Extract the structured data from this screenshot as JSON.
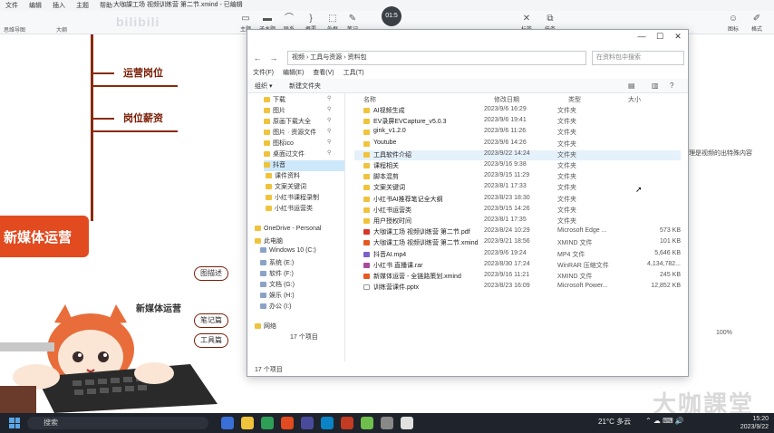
{
  "app": {
    "menu": [
      "文件",
      "编辑",
      "插入",
      "主题",
      "帮助"
    ],
    "title": "大咖課工场 视频训练营 第二节.xmind - 已编辑",
    "left_tools": [
      "思维导图",
      "大纲"
    ],
    "timer": "01:5",
    "toolbar_right": [
      "图标",
      "格式"
    ],
    "toolbar_mid": [
      "主题",
      "子主题",
      "联系",
      "概要",
      "外框",
      "笔记",
      "标签",
      "任务"
    ],
    "watermark": "bilibili"
  },
  "mindmap": {
    "central": "新媒体运营",
    "topics": [
      "运营岗位",
      "岗位薪资"
    ],
    "sub_topic": "新媒体运营",
    "small_nodes": [
      "图描述",
      "笔记篇",
      "工具篇"
    ],
    "right_note": "理是视频的出特殊内容",
    "corner_watermark": "大咖課堂",
    "zoom": "100%"
  },
  "explorer": {
    "address": [
      "视频",
      "工具与资源",
      "资料包"
    ],
    "search_placeholder": "在资料包中搜索",
    "menu": [
      "文件(F)",
      "编辑(E)",
      "查看(V)",
      "工具(T)"
    ],
    "commands": [
      "组织 ▾",
      "新建文件夹"
    ],
    "nav_items": [
      {
        "label": "下载",
        "pinned": true
      },
      {
        "label": "图片",
        "pinned": true
      },
      {
        "label": "原画下载大全",
        "pinned": true
      },
      {
        "label": "图片 · 资源文件",
        "pinned": true
      },
      {
        "label": "图标ico",
        "pinned": true
      },
      {
        "label": "桌面过文件",
        "pinned": true
      },
      {
        "label": "抖音",
        "selected": true
      },
      {
        "label": "课件资料"
      },
      {
        "label": "文案关键词"
      },
      {
        "label": "小红书课程录制"
      },
      {
        "label": "小红书运营类"
      },
      {
        "label": "OneDrive - Personal"
      },
      {
        "label": "此电脑"
      },
      {
        "label": "Windows 10 (C:)"
      },
      {
        "label": "系统 (E:)"
      },
      {
        "label": "软件 (F:)"
      },
      {
        "label": "文档 (G:)"
      },
      {
        "label": "娱乐 (H:)"
      },
      {
        "label": "办公 (I:)"
      },
      {
        "label": "网络"
      }
    ],
    "columns": [
      "名称",
      "修改日期",
      "类型",
      "大小"
    ],
    "files": [
      {
        "name": "AI视频生成",
        "date": "2023/9/6 16:29",
        "type": "文件夹",
        "size": "",
        "icon": "folder"
      },
      {
        "name": "EV录屏EVCapture_v5.0.3",
        "date": "2023/9/6 19:41",
        "type": "文件夹",
        "size": "",
        "icon": "folder"
      },
      {
        "name": "gink_v1.2.0",
        "date": "2023/9/6 11:26",
        "type": "文件夹",
        "size": "",
        "icon": "folder"
      },
      {
        "name": "Youtube",
        "date": "2023/9/6 14:26",
        "type": "文件夹",
        "size": "",
        "icon": "folder"
      },
      {
        "name": "工具软件介绍",
        "date": "2023/9/22 14:24",
        "type": "文件夹",
        "size": "",
        "icon": "folder"
      },
      {
        "name": "课程相关",
        "date": "2023/9/16 9:38",
        "type": "文件夹",
        "size": "",
        "icon": "folder"
      },
      {
        "name": "脚本混剪",
        "date": "2023/9/15 11:29",
        "type": "文件夹",
        "size": "",
        "icon": "folder"
      },
      {
        "name": "文案关键词",
        "date": "2023/8/1 17:33",
        "type": "文件夹",
        "size": "",
        "icon": "folder"
      },
      {
        "name": "小红书AI推荐笔记全大纲",
        "date": "2023/8/23 18:30",
        "type": "文件夹",
        "size": "",
        "icon": "folder"
      },
      {
        "name": "小红书运营类",
        "date": "2023/9/15 14:26",
        "type": "文件夹",
        "size": "",
        "icon": "folder"
      },
      {
        "name": "用户授权时间",
        "date": "2023/8/1 17:35",
        "type": "文件夹",
        "size": "",
        "icon": "folder"
      },
      {
        "name": "大咖课工场 视频训练营 第二节.pdf",
        "date": "2023/8/24 10:29",
        "type": "Microsoft Edge ...",
        "size": "573 KB",
        "icon": "pdf"
      },
      {
        "name": "大咖课工场 视频训练营 第二节.xmind",
        "date": "2023/9/21 18:56",
        "type": "XMIND 文件",
        "size": "101 KB",
        "icon": "xm"
      },
      {
        "name": "抖音AI.mp4",
        "date": "2023/9/6 19:24",
        "type": "MP4 文件",
        "size": "5,646 KB",
        "icon": "mp4"
      },
      {
        "name": "小红书 直播课.rar",
        "date": "2023/8/30 17:24",
        "type": "WinRAR 压缩文件",
        "size": "4,134,782...",
        "icon": "rar"
      },
      {
        "name": "新媒体运营 - 全链路策划.xmind",
        "date": "2023/9/16 11:21",
        "type": "XMIND 文件",
        "size": "245 KB",
        "icon": "xm"
      },
      {
        "name": "训练营课件.pptx",
        "date": "2023/8/23 16:09",
        "type": "Microsoft Power...",
        "size": "12,852 KB",
        "icon": "ppt"
      }
    ],
    "item_count_inner": "17 个项目",
    "item_count": "17 个项目"
  },
  "taskbar": {
    "search": "搜索",
    "weather": "21°C 多云",
    "time": "15:20",
    "date": "2023/9/22"
  }
}
